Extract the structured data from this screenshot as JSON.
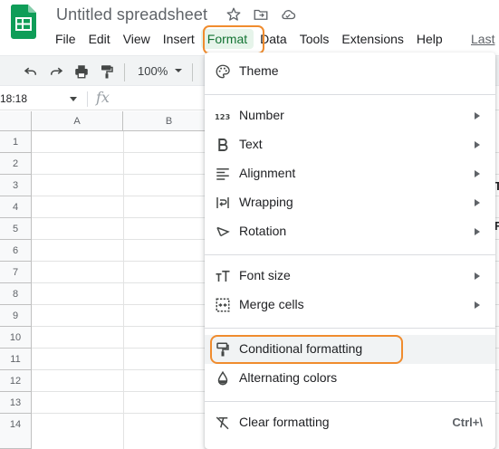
{
  "app": {
    "doc_title": "Untitled spreadsheet",
    "last_edit": "Last"
  },
  "menu": {
    "items": [
      "File",
      "Edit",
      "View",
      "Insert",
      "Format",
      "Data",
      "Tools",
      "Extensions",
      "Help"
    ],
    "active": "Format"
  },
  "toolbar": {
    "zoom": "100%"
  },
  "formula_bar": {
    "name_box": "18:18",
    "fx": "fx"
  },
  "grid": {
    "columns": [
      "A",
      "B"
    ],
    "rows": [
      "1",
      "2",
      "3",
      "4",
      "5",
      "6",
      "7",
      "8",
      "9",
      "10",
      "11",
      "12",
      "13",
      "14"
    ],
    "peek_chars": [
      "T",
      "F"
    ]
  },
  "format_menu": {
    "theme": "Theme",
    "number": "Number",
    "text": "Text",
    "alignment": "Alignment",
    "wrapping": "Wrapping",
    "rotation": "Rotation",
    "font_size": "Font size",
    "merge_cells": "Merge cells",
    "conditional_formatting": "Conditional formatting",
    "alternating_colors": "Alternating colors",
    "clear_formatting": "Clear formatting",
    "clear_formatting_shortcut": "Ctrl+\\"
  },
  "colors": {
    "sheets_green": "#0f9d58",
    "highlight_orange": "#f08c2e",
    "active_menu_bg": "#e6f4ea"
  }
}
